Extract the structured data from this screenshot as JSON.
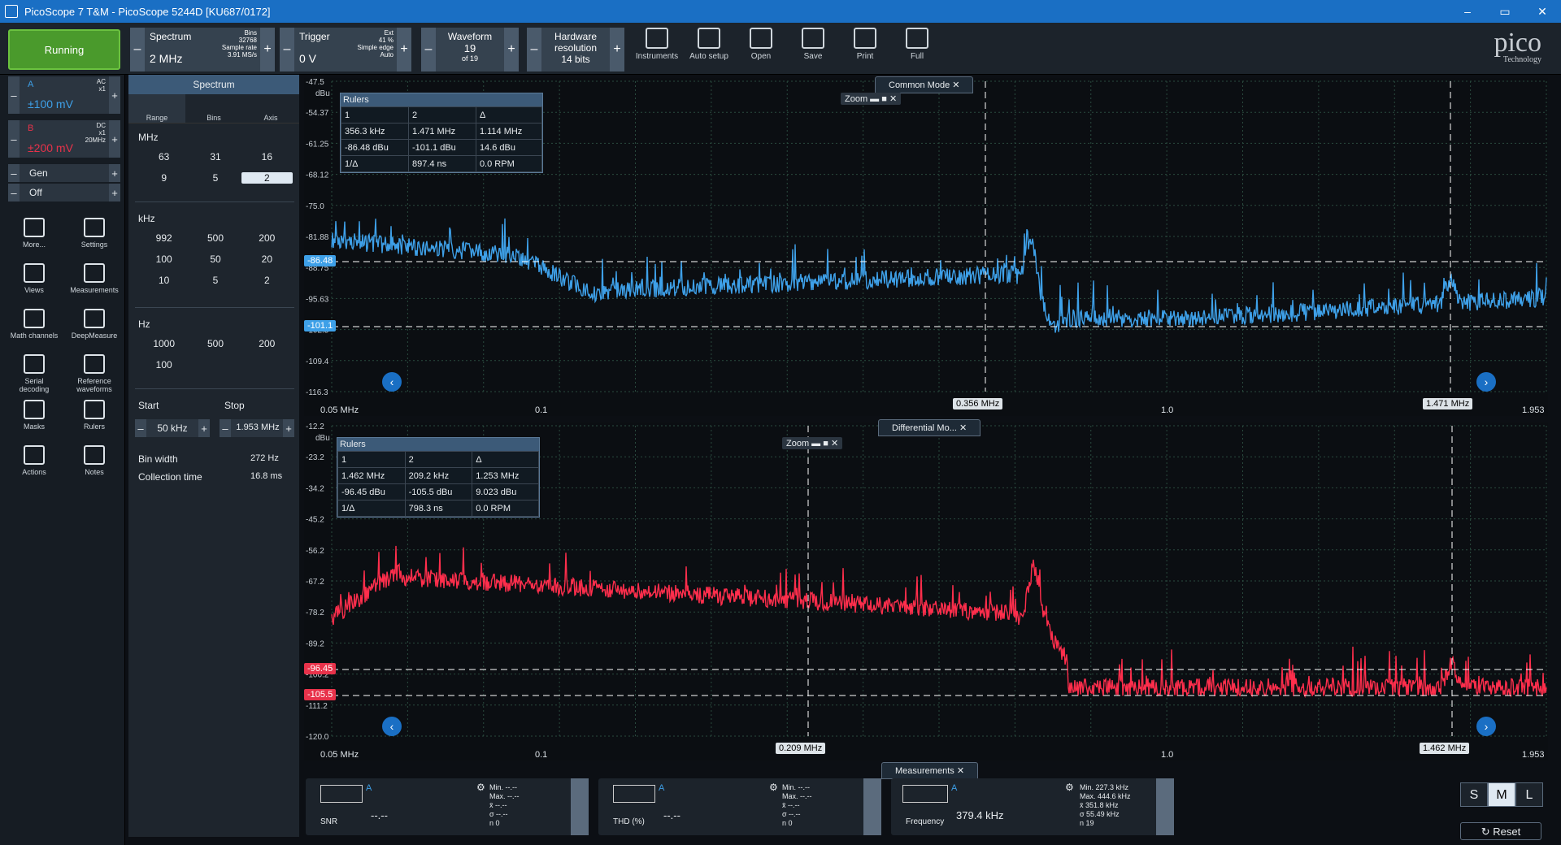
{
  "window": {
    "title": "PicoScope 7 T&M - PicoScope 5244D [KU687/0172]",
    "controls": [
      "–",
      "▭",
      "✕"
    ]
  },
  "toolbar": {
    "run": "Running",
    "spectrum": {
      "label": "Spectrum",
      "value": "2 MHz",
      "bins_label": "Bins",
      "bins": "32768",
      "sample_label": "Sample rate",
      "sample_rate": "3.91 MS/s"
    },
    "trigger": {
      "label": "Trigger",
      "value": "0 V",
      "source": "Ext",
      "percent": "41 %",
      "type": "Simple edge",
      "mode": "Auto"
    },
    "waveform": {
      "label": "Waveform",
      "value": "19",
      "of": "of 19"
    },
    "hardware": {
      "label": "Hardware resolution",
      "value": "14 bits"
    },
    "buttons": [
      "Instruments",
      "Auto setup",
      "Open",
      "Save",
      "Print",
      "Full"
    ],
    "logo": "pico",
    "logo_sub": "Technology"
  },
  "channels": [
    {
      "name": "A",
      "coupling": "AC",
      "probe": "x1",
      "range": "±100 mV",
      "color": "#3ea0e8"
    },
    {
      "name": "B",
      "coupling": "DC",
      "probe": "x1",
      "bw": "20MHz",
      "range": "±200 mV",
      "color": "#e8324a"
    },
    {
      "name": "Gen"
    },
    {
      "name": "Off"
    }
  ],
  "tools": [
    "More...",
    "Settings",
    "Views",
    "Measurements",
    "Math channels",
    "DeepMeasure",
    "Serial decoding",
    "Reference waveforms",
    "Masks",
    "Rulers",
    "Actions",
    "Notes"
  ],
  "panel": {
    "title": "Spectrum",
    "tabs": [
      "Range",
      "Bins",
      "Axis"
    ],
    "mhz_label": "MHz",
    "mhz": [
      "63",
      "31",
      "16",
      "9",
      "5",
      "2"
    ],
    "khz_label": "kHz",
    "khz": [
      "992",
      "500",
      "200",
      "100",
      "50",
      "20",
      "10",
      "5",
      "2"
    ],
    "hz_label": "Hz",
    "hz": [
      "1000",
      "500",
      "200",
      "100"
    ],
    "start_label": "Start",
    "stop_label": "Stop",
    "start": "50 kHz",
    "stop": "1.953 MHz",
    "binwidth_label": "Bin width",
    "binwidth": "272 Hz",
    "coll_label": "Collection time",
    "coll": "16.8 ms"
  },
  "top_view": {
    "tag": "Common Mode",
    "unit": "dBu",
    "yticks": [
      "-47.5",
      "-54.37",
      "-61.25",
      "-68.12",
      "-75.0",
      "-81.88",
      "-88.75",
      "-95.63",
      "-102.5",
      "-109.4",
      "-116.3"
    ],
    "xticks": [
      "0.05 MHz",
      "0.1",
      "1.0",
      "1.953"
    ],
    "cursor1": "0.356 MHz",
    "cursor2": "1.471 MHz",
    "rul1": "-86.48",
    "rul2": "-101.1",
    "rulers": {
      "title": "Rulers",
      "h": [
        "1",
        "2",
        "Δ"
      ],
      "r1": [
        "356.3 kHz",
        "1.471 MHz",
        "1.114 MHz"
      ],
      "r2": [
        "-86.48 dBu",
        "-101.1 dBu",
        "14.6 dBu"
      ],
      "r3": [
        "1/Δ",
        "897.4 ns",
        "0.0 RPM"
      ]
    },
    "zoom": "Zoom"
  },
  "bottom_view": {
    "tag": "Differential Mo...",
    "unit": "dBu",
    "yticks": [
      "-12.2",
      "-23.2",
      "-34.2",
      "-45.2",
      "-56.2",
      "-67.2",
      "-78.2",
      "-89.2",
      "-100.2",
      "-111.2",
      "-120.0"
    ],
    "xticks": [
      "0.05 MHz",
      "0.1",
      "1.0",
      "1.953"
    ],
    "cursor1": "0.209 MHz",
    "cursor2": "1.462 MHz",
    "rul1": "-96.45",
    "rul2": "-105.5",
    "rulers": {
      "title": "Rulers",
      "h": [
        "1",
        "2",
        "Δ"
      ],
      "r1": [
        "1.462 MHz",
        "209.2 kHz",
        "1.253 MHz"
      ],
      "r2": [
        "-96.45 dBu",
        "-105.5 dBu",
        "9.023 dBu"
      ],
      "r3": [
        "1/Δ",
        "798.3 ns",
        "0.0 RPM"
      ]
    },
    "zoom": "Zoom"
  },
  "measurements": {
    "tag": "Measurements",
    "items": [
      {
        "name": "SNR",
        "ch": "A",
        "value": "--.--",
        "stats": [
          "Min. --.--",
          "Max. --.--",
          "x̄ --.--",
          "σ --.--",
          "n 0"
        ]
      },
      {
        "name": "THD (%)",
        "ch": "A",
        "value": "--.--",
        "stats": [
          "Min. --.--",
          "Max. --.--",
          "x̄ --.--",
          "σ --.--",
          "n 0"
        ]
      },
      {
        "name": "Frequency",
        "ch": "A",
        "value": "379.4 kHz",
        "stats": [
          "Min. 227.3 kHz",
          "Max. 444.6 kHz",
          "x̄ 351.8 kHz",
          "σ 55.49 kHz",
          "n 19"
        ]
      }
    ]
  },
  "size_buttons": [
    "S",
    "M",
    "L"
  ],
  "reset": "Reset"
}
